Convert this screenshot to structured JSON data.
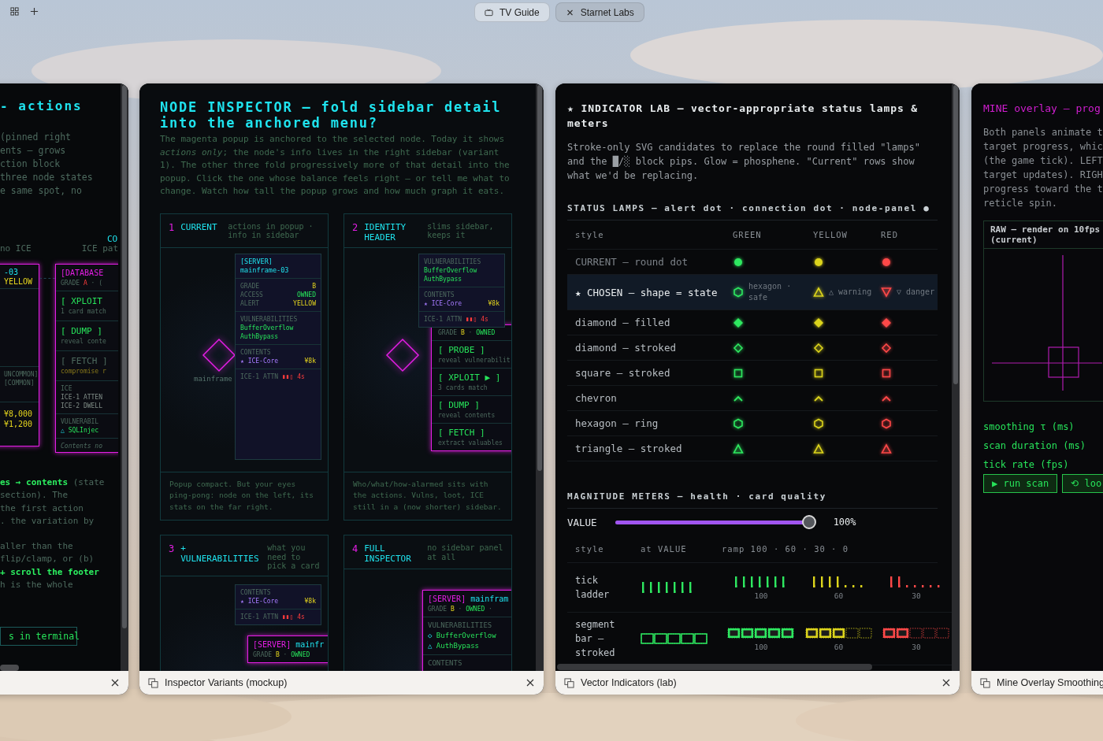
{
  "desktop": {
    "tabs": [
      {
        "label": "TV Guide",
        "selected": false
      },
      {
        "label": "Starnet Labs",
        "selected": true
      }
    ]
  },
  "actions_window": {
    "title": "- actions",
    "intro_lines": [
      "(pinned right",
      "ents — grows",
      "ction block",
      "three node states",
      "e same spot, no"
    ],
    "corner_label": "CO",
    "column_labels": [
      "no ICE",
      "ICE pat"
    ],
    "node_card": {
      "sections": [
        {
          "kind": "header",
          "lines": [
            [
              {
                "text": "-03",
                "kind": "name"
              }
            ],
            [
              {
                "text": "YELLOW",
                "kind": "warn"
              }
            ]
          ]
        },
        {
          "kind": "info",
          "lines": [
            [
              {
                "text": "UNCOMMON]",
                "kind": "label"
              }
            ],
            [
              {
                "text": "[COMMON]",
                "kind": "label"
              }
            ]
          ]
        },
        {
          "kind": "info",
          "lines": [
            [
              {
                "text": "¥8,000",
                "kind": "warn"
              }
            ],
            [
              {
                "text": "¥1,200",
                "kind": "warn"
              }
            ]
          ]
        }
      ]
    },
    "database_card": {
      "sections": [
        {
          "kind": "header",
          "lines": [
            [
              {
                "text": "[DATABASE",
                "kind": "type"
              }
            ],
            [
              {
                "text": "GRADE ",
                "kind": "label"
              },
              {
                "text": "A",
                "kind": "alert"
              },
              {
                "text": " · (",
                "kind": "label"
              }
            ]
          ]
        },
        {
          "kind": "action",
          "lines": [
            [
              {
                "text": "[ XPLOIT",
                "kind": "ok"
              }
            ],
            [
              {
                "text": "1 card match",
                "kind": "label"
              }
            ]
          ]
        },
        {
          "kind": "action",
          "lines": [
            [
              {
                "text": "[ DUMP ]",
                "kind": "ok"
              }
            ],
            [
              {
                "text": "reveal conte",
                "kind": "label"
              }
            ]
          ]
        },
        {
          "kind": "action",
          "lines": [
            [
              {
                "text": "[ FETCH ]",
                "kind": "label"
              }
            ],
            [
              {
                "text": "compromise r",
                "kind": "hint"
              }
            ]
          ]
        },
        {
          "kind": "info",
          "lines": [
            [
              {
                "text": "ICE",
                "kind": "label"
              }
            ],
            [
              {
                "text": "ICE-1 ATTEN",
                "kind": "detail"
              }
            ],
            [
              {
                "text": "ICE-2 DWELL",
                "kind": "detail"
              }
            ]
          ]
        },
        {
          "kind": "info",
          "lines": [
            [
              {
                "text": "VULNERABIL",
                "kind": "label"
              }
            ],
            [
              {
                "text": "△ ",
                "kind": "name"
              },
              {
                "text": "SQLInjec",
                "kind": "ok"
              }
            ]
          ]
        },
        {
          "kind": "info",
          "lines": [
            [
              {
                "text": "Contents no",
                "kind": "note"
              }
            ]
          ]
        }
      ]
    },
    "outro_paragraphs": [
      [
        [
          {
            "text": "es → contents",
            "kind": "emphasis"
          },
          {
            "text": " (state",
            "kind": "label"
          }
        ],
        [
          {
            "text": " section). The",
            "kind": "label"
          }
        ],
        [
          {
            "text": " the first action",
            "kind": "label"
          }
        ],
        [
          {
            "text": ". the variation by",
            "kind": "label"
          }
        ]
      ],
      [
        [
          {
            "text": "aller than the",
            "kind": "label"
          }
        ],
        [
          {
            "text": "flip/clamp, or (b)",
            "kind": "label"
          }
        ],
        [
          {
            "text": "+ scroll the footer",
            "kind": "emphasis"
          }
        ],
        [
          {
            "text": "h is the whole",
            "kind": "label"
          }
        ]
      ]
    ],
    "button": "s in terminal"
  },
  "inspector_window": {
    "title": "NODE INSPECTOR — fold sidebar detail into the anchored menu?",
    "intro": "The magenta popup is anchored to the selected node. Today it shows *actions only*; the node's info lives in the right sidebar (variant 1). The other three fold progressively more of that detail into the popup. Click the one whose balance feels right — or tell me what to change. Watch how tall the popup grows and how much graph it eats.",
    "caption": "Inspector Variants (mockup)",
    "variants": [
      {
        "number": "1",
        "title": "CURRENT",
        "note": "actions in popup · info in sidebar",
        "node": true,
        "node_label": "mainframe",
        "footer": "Popup compact. But your eyes ping-pong: node on the left, its stats on the far right.",
        "sidebar": {
          "sections": [
            {
              "kind": "header",
              "lines": [
                [
                  {
                    "text": "[SERVER]",
                    "kind": "name"
                  }
                ],
                [
                  {
                    "text": "mainframe-03",
                    "kind": "name"
                  }
                ]
              ]
            },
            {
              "kind": "stats",
              "lines": [
                [
                  {
                    "text": "GRADE",
                    "kind": "label"
                  },
                  {
                    "text": "B",
                    "kind": "warn"
                  }
                ],
                [
                  {
                    "text": "ACCESS",
                    "kind": "label"
                  },
                  {
                    "text": "OWNED",
                    "kind": "ok"
                  }
                ],
                [
                  {
                    "text": "ALERT",
                    "kind": "label"
                  },
                  {
                    "text": "YELLOW",
                    "kind": "warn"
                  }
                ]
              ]
            },
            {
              "kind": "info",
              "lines": [
                [
                  {
                    "text": "VULNERABILITIES",
                    "kind": "label"
                  }
                ],
                [
                  {
                    "text": "BufferOverflow",
                    "kind": "ok"
                  }
                ],
                [
                  {
                    "text": "AuthBypass",
                    "kind": "ok"
                  }
                ]
              ]
            },
            {
              "kind": "info",
              "lines": [
                [
                  {
                    "text": "CONTENTS",
                    "kind": "label"
                  }
                ],
                [
                  {
                    "text": "★ ICE-Core",
                    "kind": "item"
                  },
                  {
                    "text": "¥8k",
                    "kind": "warn"
                  }
                ]
              ]
            },
            {
              "kind": "info",
              "lines": [
                [
                  {
                    "text": "ICE-1 ATTN ",
                    "kind": "label"
                  },
                  {
                    "text": "▮▮▯ 4s",
                    "kind": "alert"
                  }
                ]
              ]
            }
          ]
        }
      },
      {
        "number": "2",
        "title": "IDENTITY HEADER",
        "note": "slims sidebar, keeps it",
        "node": true,
        "footer": "Who/what/how-alarmed sits with the actions. Vulns, loot, ICE still in a (now shorter) sidebar.",
        "sidebar": {
          "sections": [
            {
              "kind": "info",
              "lines": [
                [
                  {
                    "text": "VULNERABILITIES",
                    "kind": "label"
                  }
                ],
                [
                  {
                    "text": "BufferOverflow",
                    "kind": "ok"
                  }
                ],
                [
                  {
                    "text": "AuthBypass",
                    "kind": "ok"
                  }
                ]
              ]
            },
            {
              "kind": "info",
              "lines": [
                [
                  {
                    "text": "CONTENTS",
                    "kind": "label"
                  }
                ],
                [
                  {
                    "text": "★ ICE-Core",
                    "kind": "item"
                  },
                  {
                    "text": "¥8k",
                    "kind": "warn"
                  }
                ]
              ]
            },
            {
              "kind": "info",
              "lines": [
                [
                  {
                    "text": "ICE-1 ATTN ",
                    "kind": "label"
                  },
                  {
                    "text": "▮▮▯ 4s",
                    "kind": "alert"
                  }
                ]
              ]
            }
          ]
        },
        "popup": {
          "sections": [
            {
              "kind": "header",
              "lines": [
                [
                  {
                    "text": "GRADE ",
                    "kind": "label"
                  },
                  {
                    "text": "B",
                    "kind": "warn"
                  },
                  {
                    "text": " · ",
                    "kind": "label"
                  },
                  {
                    "text": "OWNED",
                    "kind": "ok"
                  }
                ]
              ]
            },
            {
              "kind": "action",
              "lines": [
                [
                  {
                    "text": "[ PROBE ]",
                    "kind": "ok"
                  }
                ],
                [
                  {
                    "text": "reveal vulnerabilit",
                    "kind": "label"
                  }
                ]
              ]
            },
            {
              "kind": "action",
              "lines": [
                [
                  {
                    "text": "[ XPLOIT ▶ ]",
                    "kind": "ok"
                  }
                ],
                [
                  {
                    "text": "3 cards match",
                    "kind": "label"
                  }
                ]
              ]
            },
            {
              "kind": "action",
              "lines": [
                [
                  {
                    "text": "[ DUMP ]",
                    "kind": "ok"
                  }
                ],
                [
                  {
                    "text": "reveal contents",
                    "kind": "label"
                  }
                ]
              ]
            },
            {
              "kind": "action",
              "lines": [
                [
                  {
                    "text": "[ FETCH ]",
                    "kind": "ok"
                  }
                ],
                [
                  {
                    "text": "extract valuables",
                    "kind": "label"
                  }
                ]
              ]
            }
          ]
        }
      },
      {
        "number": "3",
        "title": "+ VULNERABILITIES",
        "note": "what you need to pick a card",
        "node": false,
        "sidebar": {
          "sections": [
            {
              "kind": "info",
              "lines": [
                [
                  {
                    "text": "CONTENTS",
                    "kind": "label"
                  }
                ],
                [
                  {
                    "text": "★ ICE-Core",
                    "kind": "item"
                  },
                  {
                    "text": "¥8k",
                    "kind": "warn"
                  }
                ]
              ]
            },
            {
              "kind": "info",
              "lines": [
                [
                  {
                    "text": "ICE-1 ATTN ",
                    "kind": "label"
                  },
                  {
                    "text": "▮▮▯ 4s",
                    "kind": "alert"
                  }
                ]
              ]
            }
          ]
        },
        "popup": {
          "sections": [
            {
              "kind": "header",
              "lines": [
                [
                  {
                    "text": "[SERVER] ",
                    "kind": "type"
                  },
                  {
                    "text": "mainfr",
                    "kind": "name"
                  }
                ],
                [
                  {
                    "text": "GRADE ",
                    "kind": "label"
                  },
                  {
                    "text": "B",
                    "kind": "warn"
                  },
                  {
                    "text": " · ",
                    "kind": "label"
                  },
                  {
                    "text": "OWNED",
                    "kind": "ok"
                  }
                ]
              ]
            }
          ]
        }
      },
      {
        "number": "4",
        "title": "FULL INSPECTOR",
        "note": "no sidebar panel at all",
        "node": false,
        "popup": {
          "sections": [
            {
              "kind": "header",
              "lines": [
                [
                  {
                    "text": "[SERVER] ",
                    "kind": "type"
                  },
                  {
                    "text": "mainfram",
                    "kind": "name"
                  }
                ],
                [
                  {
                    "text": "GRADE ",
                    "kind": "label"
                  },
                  {
                    "text": "B",
                    "kind": "warn"
                  },
                  {
                    "text": " · ",
                    "kind": "label"
                  },
                  {
                    "text": "OWNED",
                    "kind": "ok"
                  },
                  {
                    "text": " ·",
                    "kind": "label"
                  }
                ]
              ]
            },
            {
              "kind": "info",
              "lines": [
                [
                  {
                    "text": "VULNERABILITIES",
                    "kind": "label"
                  }
                ],
                [
                  {
                    "text": "◇ ",
                    "kind": "name"
                  },
                  {
                    "text": "BufferOverflow",
                    "kind": "ok"
                  }
                ],
                [
                  {
                    "text": "△ ",
                    "kind": "name"
                  },
                  {
                    "text": "AuthBypass",
                    "kind": "ok"
                  }
                ]
              ]
            },
            {
              "kind": "info",
              "lines": [
                [
                  {
                    "text": "CONTENTS",
                    "kind": "label"
                  }
                ]
              ]
            }
          ]
        }
      }
    ]
  },
  "indicator_window": {
    "title": "★ INDICATOR LAB — vector-appropriate status lamps & meters",
    "intro": "Stroke-only SVG candidates to replace the round filled \"lamps\" and the █/░ block pips. Glow = phosphene. \"Current\" rows show what we'd be replacing.",
    "caption": "Vector Indicators (lab)",
    "lamps": {
      "heading": "STATUS LAMPS  —  alert dot · connection dot · node-panel ●",
      "style_header": "style",
      "columns": [
        {
          "label": "GREEN",
          "color": "#2ee860"
        },
        {
          "label": "YELLOW",
          "color": "#dcd41c"
        },
        {
          "label": "RED",
          "color": "#ff4848"
        }
      ],
      "rows": [
        {
          "label": "CURRENT — round dot",
          "kind": "dot",
          "selected": false
        },
        {
          "label": "★ CHOSEN — shape = state",
          "kind": "mixed",
          "selected": true,
          "cells": [
            {
              "kind": "hexagon",
              "caption": "hexagon · safe"
            },
            {
              "kind": "triangle",
              "caption": "△ warning"
            },
            {
              "kind": "triangle-down",
              "caption": "▽ danger"
            }
          ]
        },
        {
          "label": "diamond — filled",
          "kind": "diamond-filled",
          "selected": false
        },
        {
          "label": "diamond — stroked",
          "kind": "diamond",
          "selected": false
        },
        {
          "label": "square — stroked",
          "kind": "square",
          "selected": false
        },
        {
          "label": "chevron",
          "kind": "chevron",
          "selected": false
        },
        {
          "label": "hexagon — ring",
          "kind": "hexagon",
          "selected": false
        },
        {
          "label": "triangle — stroked",
          "kind": "triangle",
          "selected": false
        }
      ]
    },
    "meters": {
      "heading": "MAGNITUDE METERS  —  health · card quality",
      "slider": {
        "label": "VALUE",
        "level": 1,
        "reading": "100%"
      },
      "headers": [
        "style",
        "at VALUE",
        "ramp  100 · 60 · 30 · 0"
      ],
      "rows": [
        {
          "kind": "ticks",
          "label": "tick ladder",
          "ramp": [
            {
              "level": 1,
              "label": "100",
              "color": "#2ee860"
            },
            {
              "level": 0.6,
              "label": "60",
              "color": "#dcd41c"
            },
            {
              "level": 0.3,
              "label": "30",
              "color": "#ff4848"
            }
          ]
        },
        {
          "kind": "segments",
          "label": "segment bar — stroked",
          "ramp": [
            {
              "level": 1,
              "label": "100",
              "color": "#2ee860"
            },
            {
              "level": 0.6,
              "label": "60",
              "color": "#dcd41c"
            },
            {
              "level": 0.4,
              "label": "30",
              "color": "#ff4848"
            }
          ]
        }
      ]
    }
  },
  "mine_window": {
    "title": "MINE overlay — prog",
    "intro_lines": [
      "Both panels animate t",
      "target progress, whic",
      "(the game tick). LEFT",
      "target updates). RIGH",
      "progress toward the t",
      "reticle spin."
    ],
    "raw_panel_title": "RAW — render on 10fps (current)",
    "controls": [
      "smoothing τ (ms)",
      "scan duration (ms)",
      "tick rate (fps)"
    ],
    "buttons": [
      "▶ run scan",
      "⟲ loo"
    ],
    "caption": "Mine Overlay Smoothing"
  }
}
